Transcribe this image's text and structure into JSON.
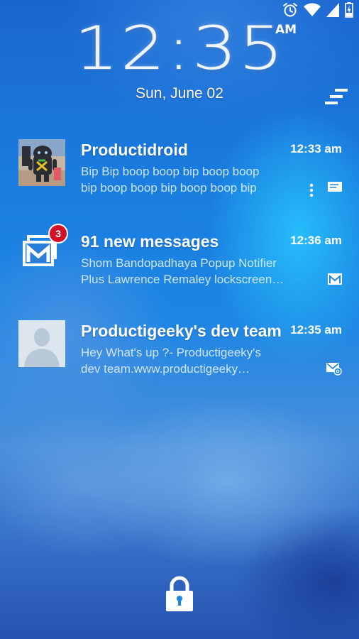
{
  "status_bar": {
    "icons": [
      "alarm-icon",
      "wifi-icon",
      "signal-icon",
      "battery-charging-icon"
    ]
  },
  "clock": {
    "time": "12:35",
    "ampm": "AM",
    "date": "Sun, June 02"
  },
  "notifications": [
    {
      "title": "Productidroid",
      "time": "12:33 am",
      "line1": "Bip Bip boop boop bip boop boop",
      "line2": "bip boop boop bip boop boop bip",
      "type_icon": "message-icon",
      "avatar": "android-figure-avatar"
    },
    {
      "title": "91 new messages",
      "time": "12:36 am",
      "line1": "Shom Bandopadhaya Popup Notifier",
      "line2": "Plus Lawrence Remaley lockscreen…",
      "type_icon": "gmail-icon",
      "badge": "3"
    },
    {
      "title": "Productigeeky's dev team",
      "time": "12:35 am",
      "line1": "Hey What's up ?- Productigeeky's",
      "line2": "dev team.www.productigeeky…",
      "type_icon": "email-at-icon",
      "avatar": "default-contact-avatar"
    }
  ],
  "colors": {
    "background": "#1d86e4",
    "badge": "#d3122a",
    "date_text": "#fff6d8"
  }
}
